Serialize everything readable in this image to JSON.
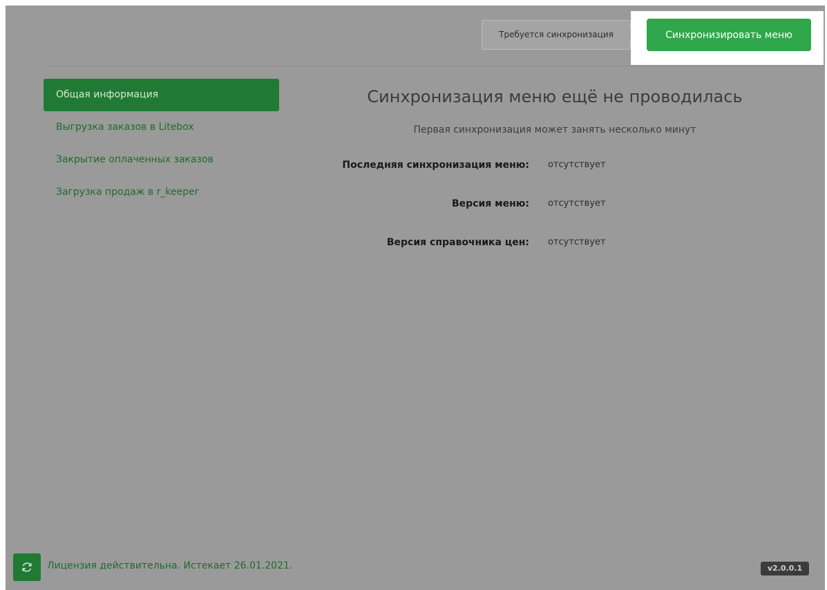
{
  "header": {
    "sync_status_text": "Требуется синхронизация",
    "sync_button_label": "Синхронизировать меню"
  },
  "sidebar": {
    "items": [
      {
        "label": "Общая информация",
        "active": true
      },
      {
        "label": "Выгрузка заказов в Litebox",
        "active": false
      },
      {
        "label": "Закрытие оплаченных заказов",
        "active": false
      },
      {
        "label": "Загрузка продаж в r_keeper",
        "active": false
      }
    ]
  },
  "main": {
    "title": "Синхронизация меню ещё не проводилась",
    "subtitle": "Первая синхронизация может занять несколько минут",
    "rows": [
      {
        "label": "Последняя синхронизация меню:",
        "value": "отсутствует"
      },
      {
        "label": "Версия меню:",
        "value": "отсутствует"
      },
      {
        "label": "Версия справочника цен:",
        "value": "отсутствует"
      }
    ]
  },
  "footer": {
    "refresh_icon": "refresh-icon",
    "license_text": "Лицензия действительна. Истекает 26.01.2021.",
    "version": "v2.0.0.1"
  },
  "colors": {
    "overlay_gray": "#9a9a9a",
    "accent_green": "#2ea84a",
    "dark_green": "#217a33"
  }
}
